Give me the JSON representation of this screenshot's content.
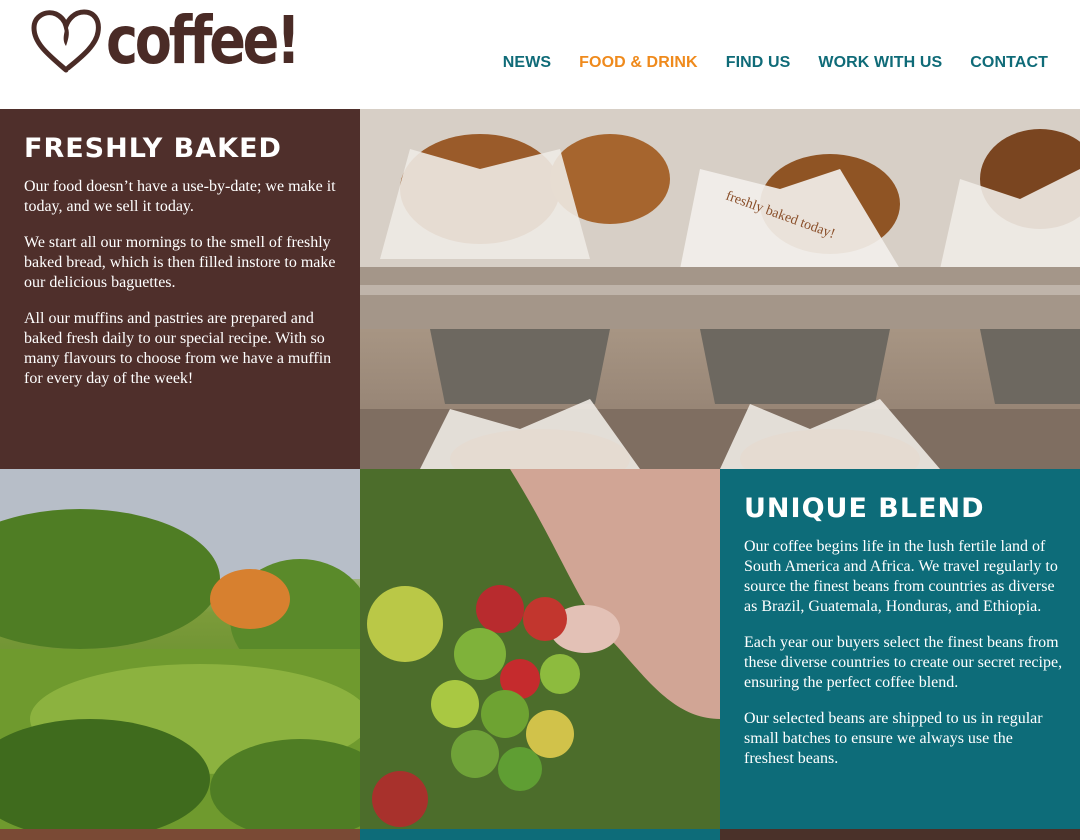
{
  "brand": {
    "logo_text": "coffee!",
    "colors": {
      "brown": "#4f2f2b",
      "teal": "#0d6c79",
      "orange": "#ef8a1c"
    }
  },
  "nav": [
    {
      "label": "NEWS",
      "active": false
    },
    {
      "label": "FOOD & DRINK",
      "active": true
    },
    {
      "label": "FIND US",
      "active": false
    },
    {
      "label": "WORK WITH US",
      "active": false
    },
    {
      "label": "CONTACT",
      "active": false
    }
  ],
  "freshly_baked": {
    "title": "FRESHLY BAKED",
    "paragraphs": [
      "Our food doesn’t have a use-by-date; we make it today, and we sell it today.",
      "We start all our mornings to the smell of freshly baked bread, which is then filled instore to make our delicious baguettes.",
      "All our muffins and pastries are prepared and baked fresh daily to our special recipe. With so many flavours to choose from we have a muffin for every day of the week!"
    ]
  },
  "unique_blend": {
    "title": "UNIQUE BLEND",
    "paragraphs": [
      "Our coffee begins life in the lush fertile land of South America and Africa. We travel regularly to source the finest beans from countries as diverse as Brazil, Guatemala, Honduras, and Ethiopia.",
      "Each year our buyers select the finest beans from these diverse countries to create our secret recipe, ensuring the perfect coffee blend.",
      "Our selected beans are shipped to us in regular small batches to ensure we always use the freshest beans."
    ]
  },
  "images": {
    "muffins": "freshly-baked-muffins-photo",
    "farm": "coffee-plantation-photo",
    "berries": "coffee-cherries-photo"
  },
  "wrapper_text": "freshly baked today!"
}
